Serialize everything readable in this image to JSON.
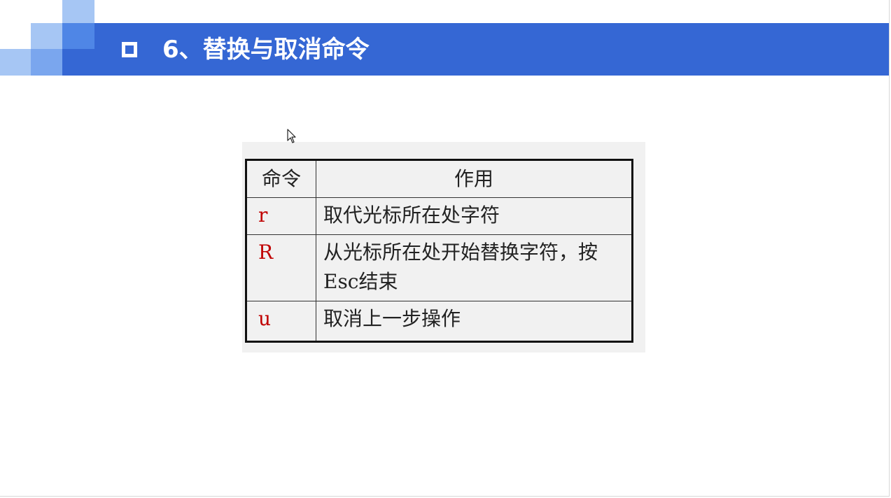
{
  "slide": {
    "title": "6、替换与取消命令"
  },
  "table": {
    "headers": [
      "命令",
      "作用"
    ],
    "rows": [
      {
        "command": "r",
        "description": "取代光标所在处字符"
      },
      {
        "command": "R",
        "description": "从光标所在处开始替换字符，按Esc结束"
      },
      {
        "command": "u",
        "description": "取消上一步操作"
      }
    ]
  },
  "colors": {
    "title_bar": "#3567d4",
    "deco_light": "#a6c6f4",
    "deco_mid": "#7aa6ee",
    "deco_dark": "#4f86e6",
    "command_text": "#c00000"
  },
  "icons": {
    "cursor": "arrow-cursor-icon",
    "bullet": "hollow-square-bullet-icon"
  }
}
